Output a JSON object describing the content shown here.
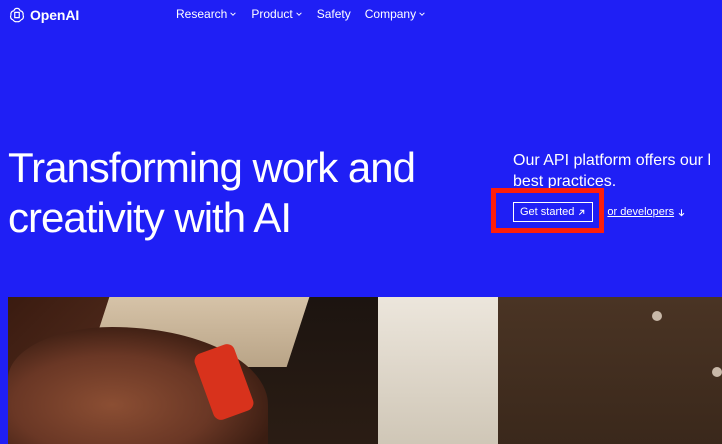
{
  "nav": {
    "logo_text": "OpenAI",
    "items": [
      {
        "label": "Research",
        "has_dropdown": true
      },
      {
        "label": "Product",
        "has_dropdown": true
      },
      {
        "label": "Safety",
        "has_dropdown": false
      },
      {
        "label": "Company",
        "has_dropdown": true
      }
    ]
  },
  "hero": {
    "title_line1": "Transforming work and",
    "title_line2": "creativity with AI",
    "subtitle_line1": "Our API platform offers our l",
    "subtitle_line2": "best practices.",
    "primary_button": "Get started",
    "secondary_link": "or developers"
  },
  "colors": {
    "background": "#1f1ff5",
    "text": "#ffffff",
    "highlight": "#ff1e0a"
  },
  "icons": {
    "logo": "openai-logo-icon",
    "dropdown": "chevron-down-icon",
    "external": "arrow-up-right-icon",
    "down": "arrow-down-icon"
  }
}
